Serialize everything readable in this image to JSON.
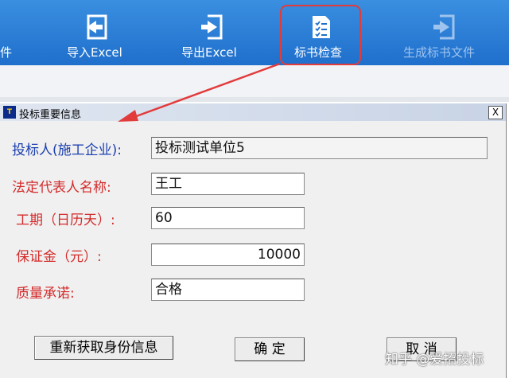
{
  "ribbon": {
    "items": [
      {
        "label": "件",
        "icon": "file-icon"
      },
      {
        "label": "导入Excel",
        "icon": "import-icon"
      },
      {
        "label": "导出Excel",
        "icon": "export-icon"
      },
      {
        "label": "标书检查",
        "icon": "checklist-icon"
      },
      {
        "label": "生成标书文件",
        "icon": "generate-file-icon"
      }
    ],
    "colors": {
      "background": "#2a7fd6",
      "highlight": "#e23b3b"
    }
  },
  "dialog": {
    "title": "投标重要信息",
    "close_label": "X",
    "fields": [
      {
        "label": "投标人(施工企业):",
        "value": "投标测试单位5"
      },
      {
        "label": "法定代表人名称:",
        "value": "王工"
      },
      {
        "label": "工期（日历天）:",
        "value": "60"
      },
      {
        "label": "保证金（元）:",
        "value": "10000"
      },
      {
        "label": "质量承诺:",
        "value": "合格"
      }
    ],
    "buttons": {
      "refresh": "重新获取身份信息",
      "ok": "确  定",
      "cancel": "取  消"
    }
  },
  "watermark": "知乎 @爱招投标"
}
